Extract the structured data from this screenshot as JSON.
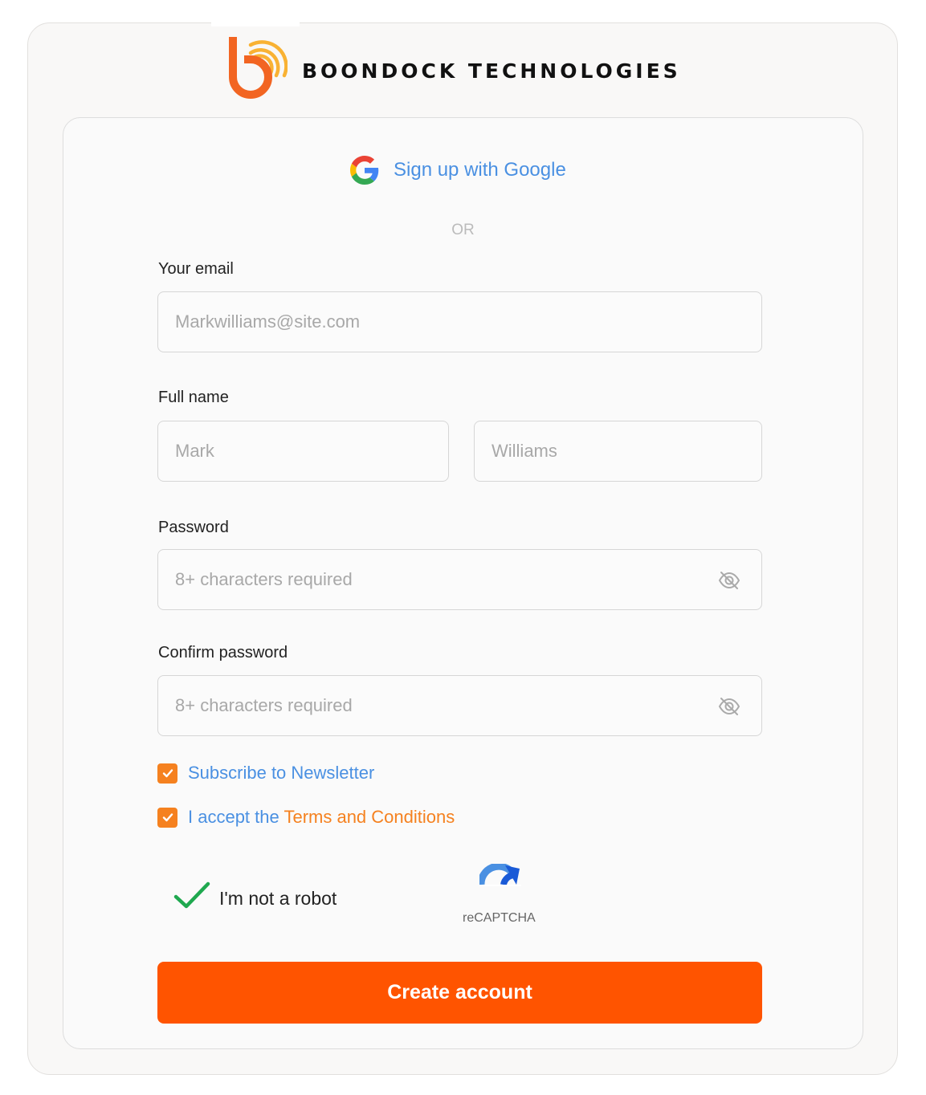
{
  "brand": {
    "name": "BOONDOCK TECHNOLOGIES",
    "logo_icon": "boondock-b-wifi-logo",
    "primary_color": "#f26522",
    "accent_color": "#f9b233"
  },
  "signup": {
    "google_label": "Sign up with Google",
    "google_icon": "google-g-icon",
    "divider_text": "OR",
    "email": {
      "label": "Your email",
      "placeholder": "Markwilliams@site.com"
    },
    "full_name": {
      "label": "Full name",
      "first_placeholder": "Mark",
      "last_placeholder": "Williams"
    },
    "password": {
      "label": "Password",
      "placeholder": "8+ characters required",
      "toggle_icon": "eye-off-icon"
    },
    "confirm_password": {
      "label": "Confirm password",
      "placeholder": "8+ characters required",
      "toggle_icon": "eye-off-icon"
    },
    "newsletter": {
      "checked": true,
      "label": "Subscribe to Newsletter"
    },
    "terms": {
      "checked": true,
      "prefix": "I accept the ",
      "link": "Terms and Conditions"
    },
    "captcha": {
      "verified": true,
      "label": "I'm not a robot",
      "brand": "reCAPTCHA"
    },
    "submit_label": "Create account"
  },
  "colors": {
    "link_blue": "#4a90e2",
    "checkbox_orange": "#f5811f",
    "button_orange": "#ff5400",
    "captcha_check_green": "#1fa84f"
  }
}
